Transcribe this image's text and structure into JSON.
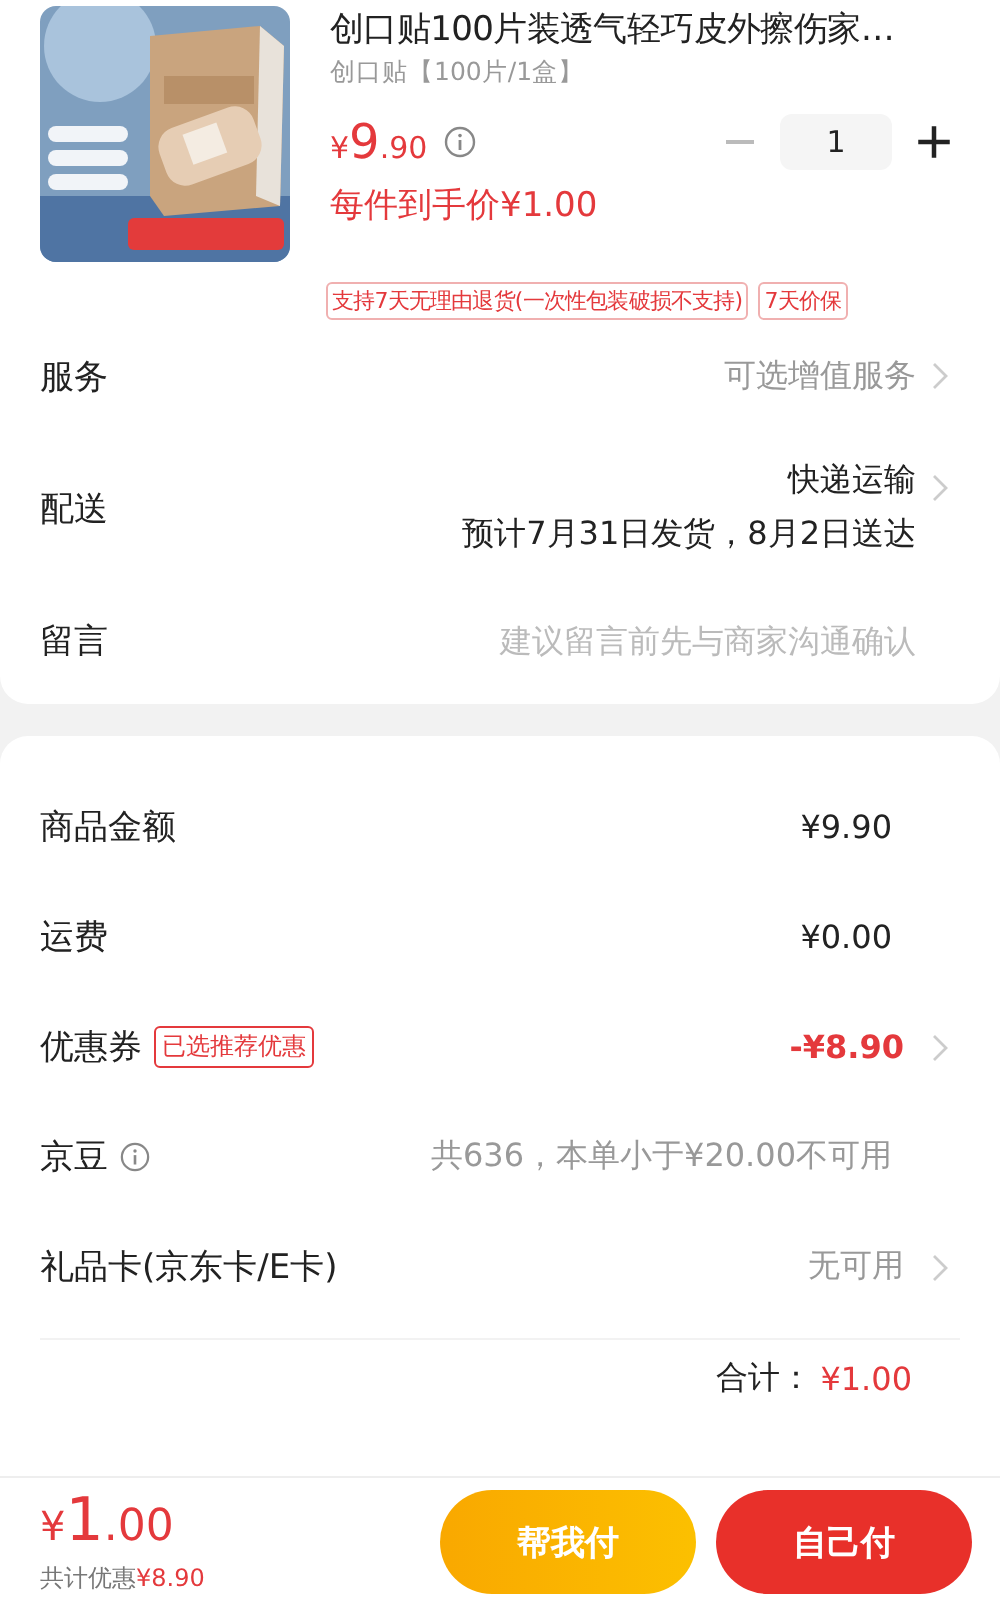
{
  "product": {
    "title": "创口贴100片装透气轻巧皮外擦伤家…",
    "spec": "创口贴【100片/1盒】",
    "price": {
      "symbol": "¥",
      "integer": "9",
      "decimal": ".90"
    },
    "quantity": "1",
    "unit_price_note": "每件到手价¥1.00",
    "tags": [
      "支持7天无理由退货(一次性包装破损不支持)",
      "7天价保"
    ]
  },
  "options": [
    {
      "kind": "link",
      "label": "服务",
      "value": "可选增值服务"
    },
    {
      "kind": "delivery",
      "label": "配送",
      "value": "快递运输",
      "note": "预计7月31日发货，8月2日送达"
    },
    {
      "kind": "input",
      "label": "留言",
      "placeholder": "建议留言前先与商家沟通确认"
    }
  ],
  "summary": [
    {
      "kind": "plain",
      "label": "商品金额",
      "value": "¥9.90"
    },
    {
      "kind": "plain",
      "label": "运费",
      "value": "¥0.00"
    },
    {
      "kind": "discount",
      "label": "优惠券",
      "badge": "已选推荐优惠",
      "value": "-¥8.90"
    },
    {
      "kind": "info",
      "label": "京豆",
      "value": "共636，本单小于¥20.00不可用"
    },
    {
      "kind": "link",
      "label": "礼品卡(京东卡/E卡)",
      "value": "无可用"
    }
  ],
  "total": {
    "label": "合计：",
    "value": "¥1.00"
  },
  "footer": {
    "symbol": "¥",
    "integer": "1",
    "decimal": ".00",
    "savings_label": "共计优惠",
    "savings_value": "¥8.90",
    "buttons": [
      {
        "kind": "secondary",
        "label": "帮我付"
      },
      {
        "kind": "primary",
        "label": "自己付"
      }
    ]
  }
}
